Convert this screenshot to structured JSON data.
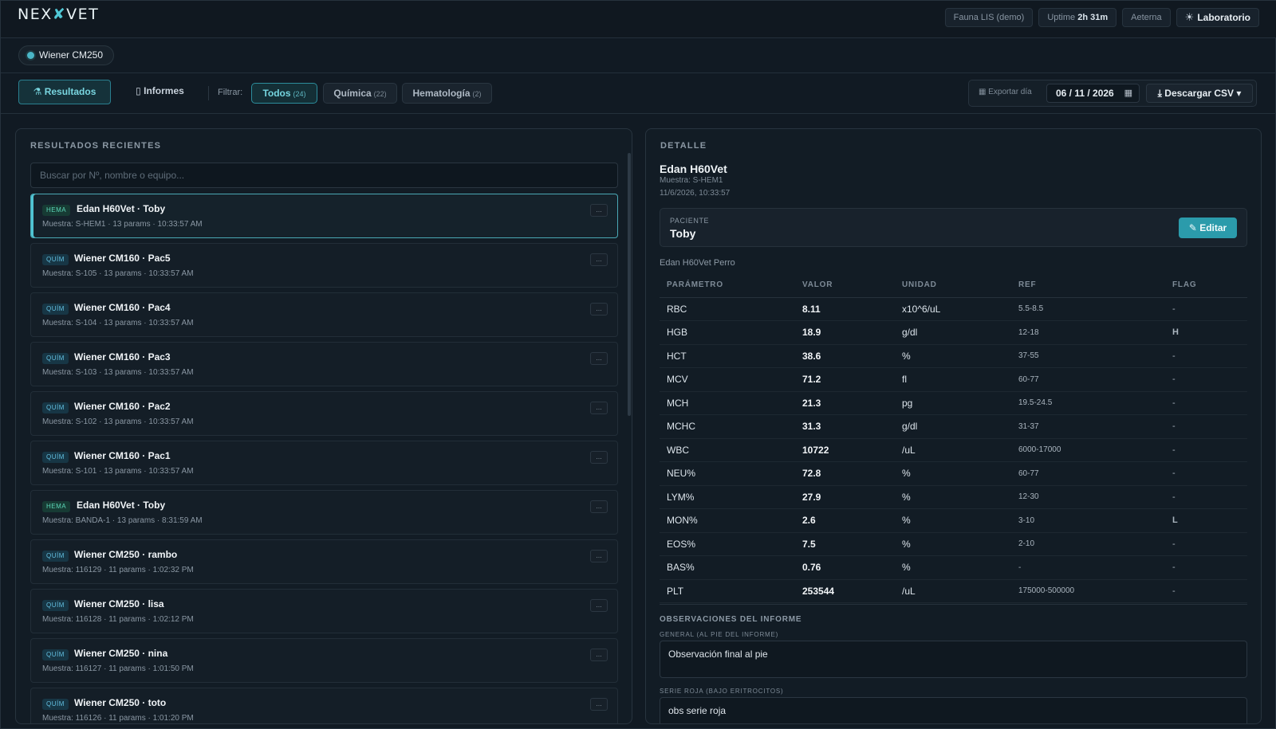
{
  "app": {
    "logo_left": "NEX",
    "logo_mid": "✘",
    "logo_right": "VET",
    "env_label": "Fauna LIS (demo)",
    "uptime_label": "Uptime",
    "uptime_value": "2h 31m",
    "theme_label": "Aeterna",
    "lab_label": "Laboratorio"
  },
  "device": {
    "name": "Wiener CM250"
  },
  "toolbar": {
    "tab_results": "Resultados",
    "tab_reports": "Informes",
    "filter_label": "Filtrar:",
    "filters": [
      {
        "label": "Todos",
        "count": "(24)"
      },
      {
        "label": "Química",
        "count": "(22)"
      },
      {
        "label": "Hematología",
        "count": "(2)"
      }
    ],
    "export_label": "Exportar día",
    "export_date": "06 / 11 / 2026",
    "csv_button": "Descargar CSV ▾"
  },
  "results": {
    "title": "RESULTADOS RECIENTES",
    "search_placeholder": "Buscar por Nº, nombre o equipo...",
    "items": [
      {
        "badge": "HEMA",
        "title": "Edan H60Vet · Toby",
        "meta": "Muestra: S-HEM1 · 13 params · 10:33:57 AM"
      },
      {
        "badge": "QUÍM",
        "title": "Wiener CM160 · Pac5",
        "meta": "Muestra: S-105 · 13 params · 10:33:57 AM"
      },
      {
        "badge": "QUÍM",
        "title": "Wiener CM160 · Pac4",
        "meta": "Muestra: S-104 · 13 params · 10:33:57 AM"
      },
      {
        "badge": "QUÍM",
        "title": "Wiener CM160 · Pac3",
        "meta": "Muestra: S-103 · 13 params · 10:33:57 AM"
      },
      {
        "badge": "QUÍM",
        "title": "Wiener CM160 · Pac2",
        "meta": "Muestra: S-102 · 13 params · 10:33:57 AM"
      },
      {
        "badge": "QUÍM",
        "title": "Wiener CM160 · Pac1",
        "meta": "Muestra: S-101 · 13 params · 10:33:57 AM"
      },
      {
        "badge": "HEMA",
        "title": "Edan H60Vet · Toby",
        "meta": "Muestra: BANDA-1 · 13 params · 8:31:59 AM"
      },
      {
        "badge": "QUÍM",
        "title": "Wiener CM250 · rambo",
        "meta": "Muestra: 116129 · 11 params · 1:02:32 PM"
      },
      {
        "badge": "QUÍM",
        "title": "Wiener CM250 · lisa",
        "meta": "Muestra: 116128 · 11 params · 1:02:12 PM"
      },
      {
        "badge": "QUÍM",
        "title": "Wiener CM250 · nina",
        "meta": "Muestra: 116127 · 11 params · 1:01:50 PM"
      },
      {
        "badge": "QUÍM",
        "title": "Wiener CM250 · toto",
        "meta": "Muestra: 116126 · 11 params · 1:01:20 PM"
      }
    ],
    "more_label": "..."
  },
  "detail": {
    "title": "DETALLE",
    "name": "Edan H60Vet",
    "sample": "Muestra: S-HEM1",
    "datetime": "11/6/2026, 10:33:57",
    "patient_label": "PACIENTE",
    "patient_name": "Toby",
    "edit_button": "Editar",
    "device_caption": "Edan H60Vet Perro",
    "columns": [
      "PARÁMETRO",
      "VALOR",
      "UNIDAD",
      "REF",
      "FLAG"
    ],
    "rows": [
      [
        "RBC",
        "8.11",
        "x10^6/uL",
        "5.5-8.5",
        "-"
      ],
      [
        "HGB",
        "18.9",
        "g/dl",
        "12-18",
        "H"
      ],
      [
        "HCT",
        "38.6",
        "%",
        "37-55",
        "-"
      ],
      [
        "MCV",
        "71.2",
        "fl",
        "60-77",
        "-"
      ],
      [
        "MCH",
        "21.3",
        "pg",
        "19.5-24.5",
        "-"
      ],
      [
        "MCHC",
        "31.3",
        "g/dl",
        "31-37",
        "-"
      ],
      [
        "WBC",
        "10722",
        "/uL",
        "6000-17000",
        "-"
      ],
      [
        "NEU%",
        "72.8",
        "%",
        "60-77",
        "-"
      ],
      [
        "LYM%",
        "27.9",
        "%",
        "12-30",
        "-"
      ],
      [
        "MON%",
        "2.6",
        "%",
        "3-10",
        "L"
      ],
      [
        "EOS%",
        "7.5",
        "%",
        "2-10",
        "-"
      ],
      [
        "BAS%",
        "0.76",
        "%",
        "-",
        "-"
      ],
      [
        "PLT",
        "253544",
        "/uL",
        "175000-500000",
        "-"
      ]
    ],
    "obs_title": "OBSERVACIONES DEL INFORME",
    "obs_general_label": "GENERAL (AL PIE DEL INFORME)",
    "obs_general_value": "Observación final al pie",
    "obs_red_label": "SERIE ROJA (BAJO ERITROCITOS)",
    "obs_red_value": "obs serie roja"
  },
  "colors": {
    "accent": "#2b9bab",
    "flag_high": "#f04b4b",
    "flag_low": "#4ea4ff",
    "badge_hema": "#5cd7b8",
    "badge_quim": "#63bfe0"
  }
}
